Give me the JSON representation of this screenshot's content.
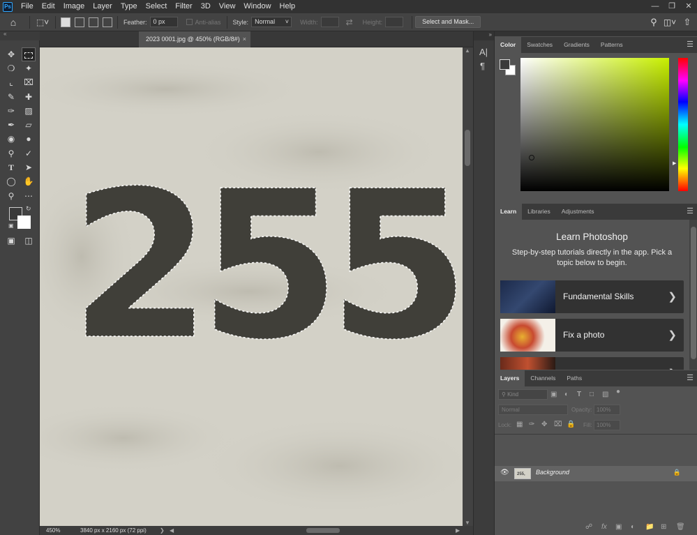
{
  "app": {
    "logo": "Ps"
  },
  "menu": [
    "File",
    "Edit",
    "Image",
    "Layer",
    "Type",
    "Select",
    "Filter",
    "3D",
    "View",
    "Window",
    "Help"
  ],
  "window_controls": [
    "minimize-icon",
    "restore-icon",
    "close-icon"
  ],
  "options_bar": {
    "feather_label": "Feather:",
    "feather_value": "0 px",
    "antialias_label": "Anti-alias",
    "style_label": "Style:",
    "style_value": "Normal",
    "width_label": "Width:",
    "height_label": "Height:",
    "select_mask_label": "Select and Mask..."
  },
  "document": {
    "tab_title": "2023 0001.jpg @ 450% (RGB/8#)",
    "close_glyph": "×",
    "zoom": "450%",
    "dimensions": "3840 px x 2160 px (72 ppi)",
    "canvas_text": "255,"
  },
  "color_panel": {
    "tabs": [
      "Color",
      "Swatches",
      "Gradients",
      "Patterns"
    ],
    "active_tab": "Color",
    "hue_color": "#c8f000",
    "foreground": "#3a3a3a",
    "background": "#ffffff"
  },
  "learn_panel": {
    "tabs": [
      "Learn",
      "Libraries",
      "Adjustments"
    ],
    "title": "Learn Photoshop",
    "subtitle": "Step-by-step tutorials directly in the app. Pick a topic below to begin.",
    "cards": [
      {
        "label": "Fundamental Skills"
      },
      {
        "label": "Fix a photo"
      },
      {
        "label": ""
      }
    ]
  },
  "layers_panel": {
    "tabs": [
      "Layers",
      "Channels",
      "Paths"
    ],
    "kind_placeholder": "Kind",
    "blend_mode": "Normal",
    "opacity_label": "Opacity:",
    "opacity_value": "100%",
    "lock_label": "Lock:",
    "fill_label": "Fill:",
    "fill_value": "100%",
    "layers": [
      {
        "name": "Background",
        "visible": true,
        "locked": true
      }
    ]
  },
  "colors": {
    "app_dark": "#323232",
    "panel": "#535353",
    "ps_blue": "#31a8ff"
  }
}
